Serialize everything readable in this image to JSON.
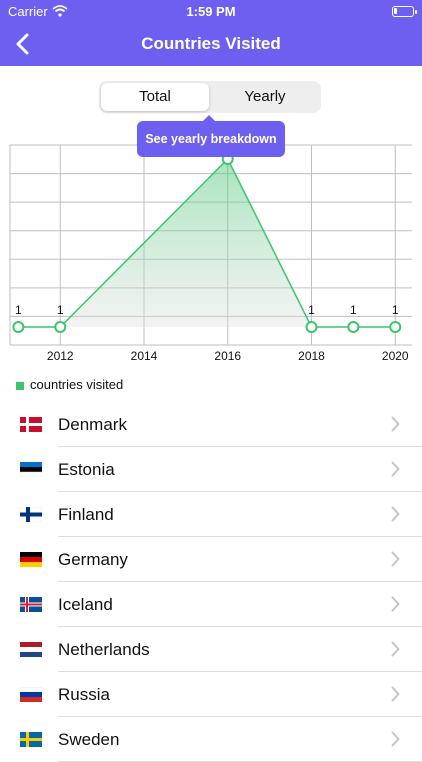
{
  "status": {
    "carrier": "Carrier",
    "time": "1:59 PM"
  },
  "header": {
    "title": "Countries Visited"
  },
  "segment": {
    "options": [
      "Total",
      "Yearly"
    ],
    "selected": "Total"
  },
  "tooltip": "See yearly breakdown",
  "chart_data": {
    "type": "area",
    "x": [
      2011,
      2012,
      2016,
      2018,
      2019,
      2020
    ],
    "values": [
      1,
      1,
      7,
      1,
      1,
      1
    ],
    "value_labels": [
      "1",
      "1",
      "",
      "1",
      "1",
      "1"
    ],
    "xticks": [
      "2012",
      "2014",
      "2016",
      "2018",
      "2020"
    ],
    "xlim": [
      2010.8,
      2020.4
    ],
    "series": [
      {
        "name": "countries visited"
      }
    ],
    "color": "#3cc46b",
    "legend": "bottom-left",
    "grid": true
  },
  "legend": {
    "label": "countries visited"
  },
  "countries": [
    {
      "name": "Denmark",
      "flag": "denmark-flag"
    },
    {
      "name": "Estonia",
      "flag": "estonia-flag"
    },
    {
      "name": "Finland",
      "flag": "finland-flag"
    },
    {
      "name": "Germany",
      "flag": "germany-flag"
    },
    {
      "name": "Iceland",
      "flag": "iceland-flag"
    },
    {
      "name": "Netherlands",
      "flag": "netherlands-flag"
    },
    {
      "name": "Russia",
      "flag": "russia-flag"
    },
    {
      "name": "Sweden",
      "flag": "sweden-flag"
    }
  ],
  "colors": {
    "accent": "#6d5ff0",
    "series": "#3cc46b"
  }
}
